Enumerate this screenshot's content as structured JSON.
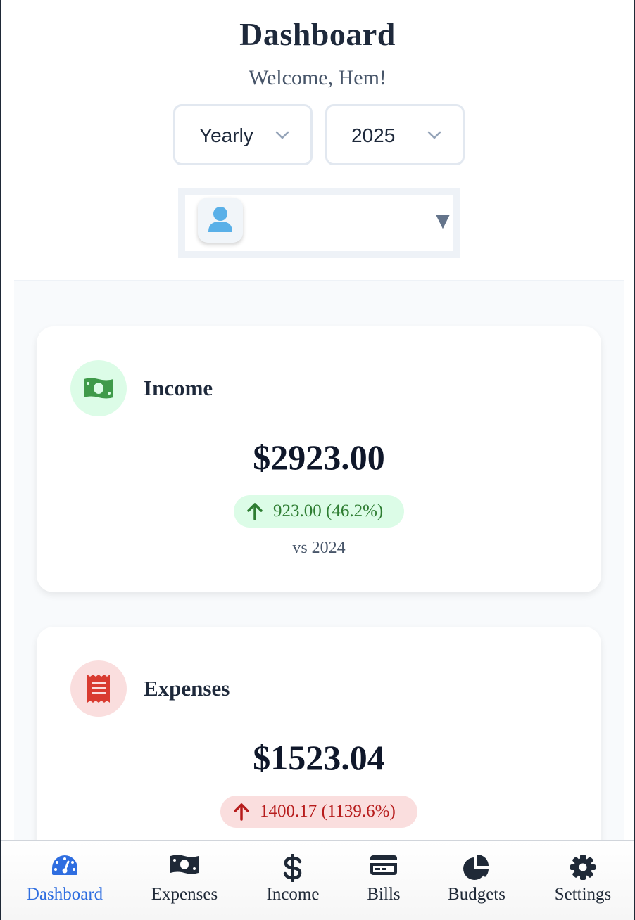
{
  "header": {
    "title": "Dashboard",
    "welcome": "Welcome, Hem!"
  },
  "filters": {
    "period": {
      "value": "Yearly",
      "icon": "chevron-down-icon"
    },
    "year": {
      "value": "2025",
      "icon": "chevron-down-icon"
    }
  },
  "user_selector": {
    "avatar_icon": "user-icon",
    "caret": "▼"
  },
  "cards": {
    "income": {
      "title": "Income",
      "icon": "money-bill-icon",
      "amount": "$2923.00",
      "change": "923.00 (46.2%)",
      "change_direction": "up",
      "comparison": "vs 2024",
      "accent": "#2e7d32",
      "icon_bg": "#dcfce7"
    },
    "expenses": {
      "title": "Expenses",
      "icon": "receipt-icon",
      "amount": "$1523.04",
      "change": "1400.17 (1139.6%)",
      "change_direction": "up",
      "accent": "#b71c1c",
      "icon_bg": "#fadede"
    }
  },
  "nav": {
    "active_color": "#2f6ee0",
    "items": [
      {
        "label": "Dashboard",
        "icon": "gauge-icon",
        "active": true
      },
      {
        "label": "Expenses",
        "icon": "money-bill-icon",
        "active": false
      },
      {
        "label": "Income",
        "icon": "dollar-icon",
        "active": false
      },
      {
        "label": "Bills",
        "icon": "credit-card-icon",
        "active": false
      },
      {
        "label": "Budgets",
        "icon": "pie-chart-icon",
        "active": false
      },
      {
        "label": "Settings",
        "icon": "gear-icon",
        "active": false
      }
    ]
  }
}
